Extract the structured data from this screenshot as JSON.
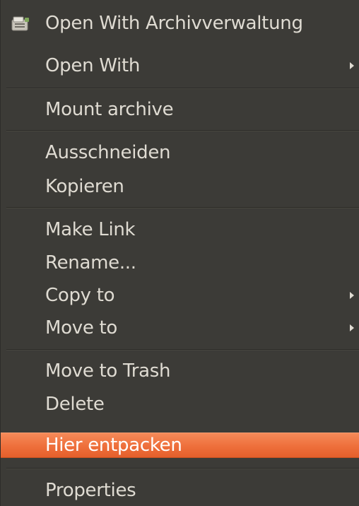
{
  "menu": {
    "items": [
      {
        "label": "Open With Archivverwaltung",
        "icon": "archive-manager-icon"
      },
      {
        "label": "Open With",
        "submenu": true
      },
      {
        "label": "Mount archive"
      },
      {
        "label": "Ausschneiden"
      },
      {
        "label": "Kopieren"
      },
      {
        "label": "Make Link"
      },
      {
        "label": "Rename..."
      },
      {
        "label": "Copy to",
        "submenu": true
      },
      {
        "label": "Move to",
        "submenu": true
      },
      {
        "label": "Move to Trash"
      },
      {
        "label": "Delete"
      },
      {
        "label": "Hier entpacken",
        "highlighted": true
      },
      {
        "label": "Properties"
      }
    ]
  },
  "colors": {
    "background": "#3c3b37",
    "text": "#dfdbd2",
    "highlight": "#ee6f3b",
    "highlight_text": "#ffffff"
  }
}
